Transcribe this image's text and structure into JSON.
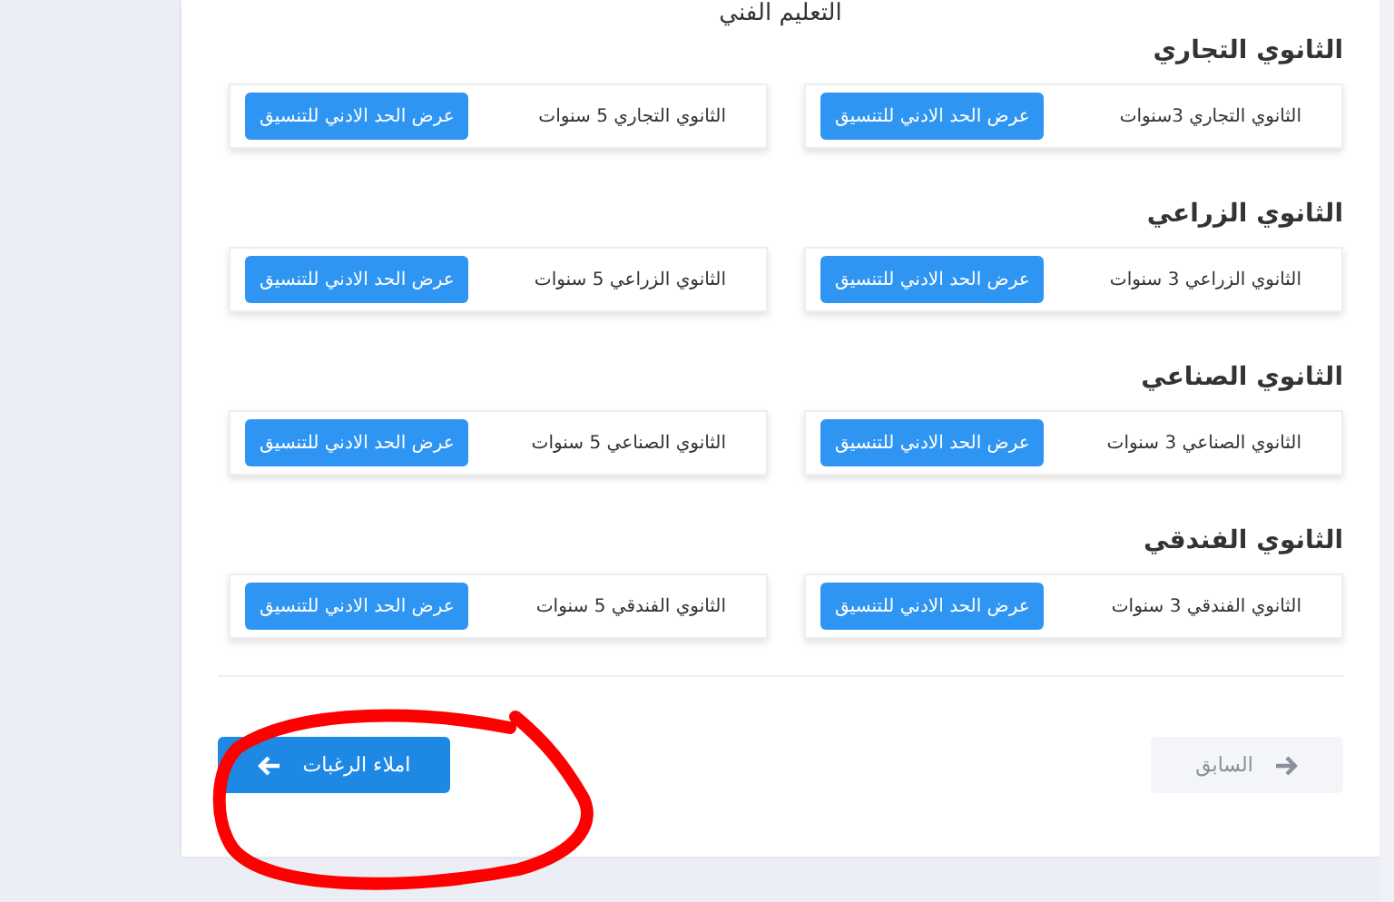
{
  "page_title": "التعليم الفني",
  "sections": [
    {
      "title": "الثانوي التجاري",
      "items": [
        {
          "label": "الثانوي التجاري 3سنوات",
          "button": "عرض الحد الادني للتنسيق"
        },
        {
          "label": "الثانوي التجاري 5 سنوات",
          "button": "عرض الحد الادني للتنسيق"
        }
      ]
    },
    {
      "title": "الثانوي الزراعي",
      "items": [
        {
          "label": "الثانوي الزراعي 3 سنوات",
          "button": "عرض الحد الادني للتنسيق"
        },
        {
          "label": "الثانوي الزراعي 5 سنوات",
          "button": "عرض الحد الادني للتنسيق"
        }
      ]
    },
    {
      "title": "الثانوي الصناعي",
      "items": [
        {
          "label": "الثانوي الصناعي 3 سنوات",
          "button": "عرض الحد الادني للتنسيق"
        },
        {
          "label": "الثانوي الصناعي 5 سنوات",
          "button": "عرض الحد الادني للتنسيق"
        }
      ]
    },
    {
      "title": "الثانوي الفندقي",
      "items": [
        {
          "label": "الثانوي الفندقي 3 سنوات",
          "button": "عرض الحد الادني للتنسيق"
        },
        {
          "label": "الثانوي الفندقي 5 سنوات",
          "button": "عرض الحد الادني للتنسيق"
        }
      ]
    }
  ],
  "previous_button": {
    "label": "السابق",
    "disabled": true
  },
  "next_button": {
    "label": "املاء الرغبات",
    "disabled": false
  },
  "annotation": {
    "kind": "circle"
  }
}
